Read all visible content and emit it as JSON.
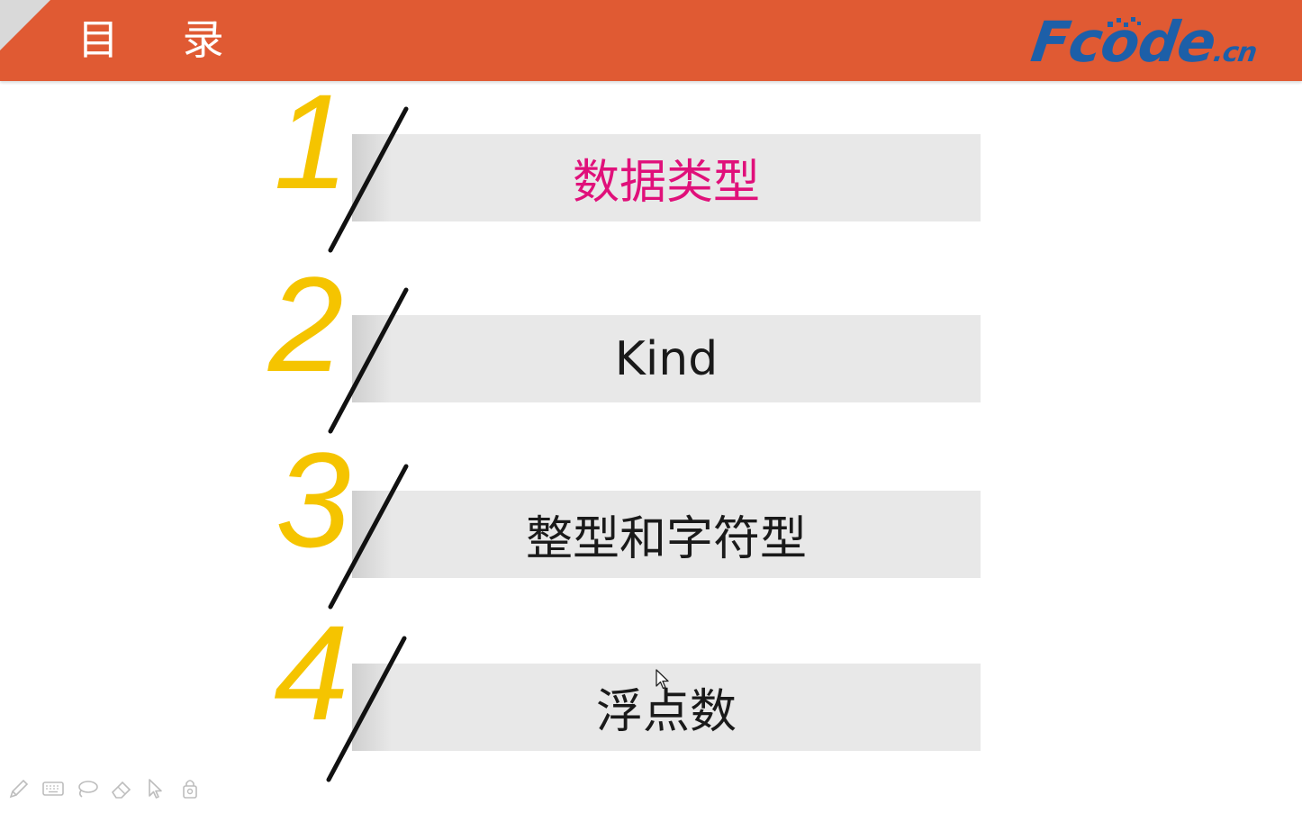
{
  "header": {
    "title": "目 录",
    "logo_main": "Fcode",
    "logo_sub": ".cn",
    "background_color": "#e05a33",
    "logo_color": "#1d5fa8"
  },
  "agenda": {
    "items": [
      {
        "number": "1",
        "label": "数据类型",
        "highlighted": true
      },
      {
        "number": "2",
        "label": "Kind",
        "highlighted": false
      },
      {
        "number": "3",
        "label": "整型和字符型",
        "highlighted": false
      },
      {
        "number": "4",
        "label": "浮点数",
        "highlighted": false
      }
    ],
    "number_color": "#f5c400",
    "highlight_color": "#e0107a"
  },
  "toolbar": {
    "tools": [
      "pen-icon",
      "keyboard-icon",
      "lasso-icon",
      "eraser-icon",
      "pointer-icon",
      "lock-icon"
    ]
  }
}
